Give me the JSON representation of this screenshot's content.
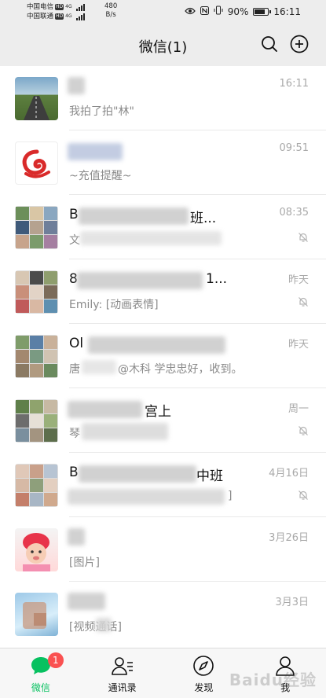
{
  "status_bar": {
    "carrier_1": "中国电信",
    "carrier_2": "中国联通",
    "hd_label": "HD",
    "net_1": "4G",
    "net_2": "4G",
    "net_speed_value": "480",
    "net_speed_unit": "B/s",
    "battery": "90%",
    "time": "16:11"
  },
  "header": {
    "title": "微信(1)",
    "search_icon": "search-icon",
    "add_icon": "plus-circle-icon"
  },
  "chats": [
    {
      "name": "",
      "preview": "我拍了拍\"林\"",
      "time": "16:11",
      "muted": false
    },
    {
      "name": "",
      "preview": "~充值提醒~",
      "time": "09:51",
      "muted": false
    },
    {
      "name": "B",
      "name_suffix": "班...",
      "preview": "文",
      "time": "08:35",
      "muted": true
    },
    {
      "name": "8",
      "name_suffix": "1...",
      "preview": "Emily: [动画表情]",
      "time": "昨天",
      "muted": true
    },
    {
      "name": "Ol",
      "name_suffix": "",
      "preview": "唐",
      "preview_suffix": "@木科 学忠忠好，收到。",
      "time": "昨天",
      "muted": false
    },
    {
      "name": "",
      "name_suffix": "宫上",
      "preview": "琴",
      "time": "周一",
      "muted": true
    },
    {
      "name": "B",
      "name_suffix": "中班",
      "preview": "",
      "preview_suffix": "]",
      "time": "4月16日",
      "muted": true
    },
    {
      "name": "",
      "preview": "[图片]",
      "time": "3月26日",
      "muted": false
    },
    {
      "name": "",
      "preview": "[视频通话]",
      "time": "3月3日",
      "muted": false
    }
  ],
  "tabs": [
    {
      "label": "微信",
      "icon": "chat-bubble-icon",
      "badge": "1",
      "active": true
    },
    {
      "label": "通讯录",
      "icon": "contacts-icon",
      "active": false
    },
    {
      "label": "发现",
      "icon": "compass-icon",
      "active": false
    },
    {
      "label": "我",
      "icon": "person-icon",
      "active": false
    }
  ],
  "watermark": "Baidu经验",
  "colors": {
    "accent": "#07c160",
    "badge": "#fa5151",
    "background": "#ededed"
  }
}
